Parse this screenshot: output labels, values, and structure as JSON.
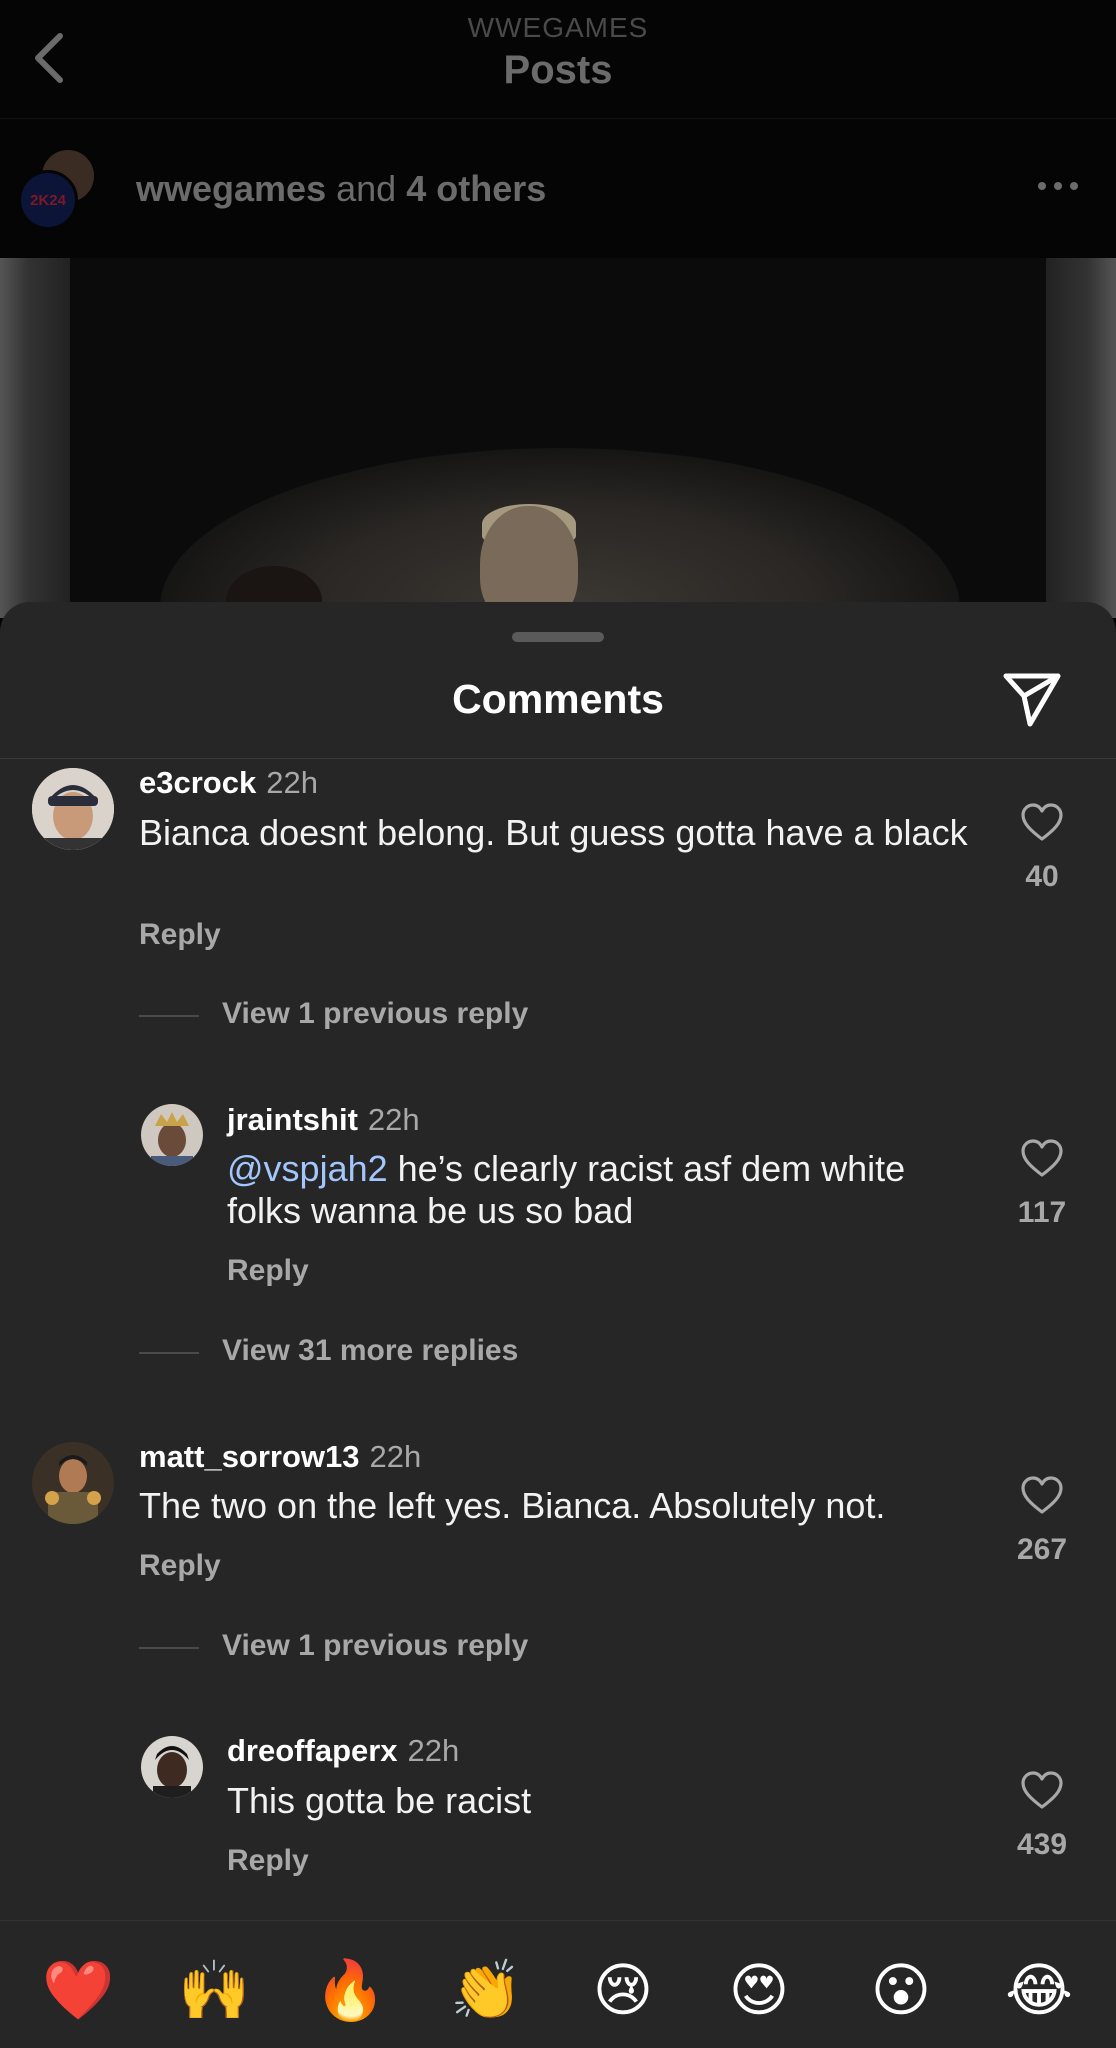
{
  "header": {
    "account": "WWEGAMES",
    "title": "Posts"
  },
  "author": {
    "name": "wwegames",
    "joiner": "and",
    "others": "4 others",
    "badge": "2K24"
  },
  "comments_sheet": {
    "title": "Comments"
  },
  "comments": [
    {
      "username": "e3crock",
      "time": "22h",
      "text": "Bianca doesnt belong. But guess gotta have a black",
      "reply": "Reply",
      "likes": "40"
    },
    {
      "view_replies": "View 1 previous reply"
    },
    {
      "username": "jraintshit",
      "time": "22h",
      "mention": "@vspjah2",
      "text": " he’s clearly racist asf dem white folks wanna be us so bad",
      "reply": "Reply",
      "likes": "117"
    },
    {
      "view_replies": "View 31 more replies"
    },
    {
      "username": "matt_sorrow13",
      "time": "22h",
      "text": "The two on the left yes. Bianca. Absolutely not.",
      "reply": "Reply",
      "likes": "267"
    },
    {
      "view_replies": "View 1 previous reply"
    },
    {
      "username": "dreoffaperx",
      "time": "22h",
      "text": "This gotta be racist",
      "reply": "Reply",
      "likes": "439"
    }
  ],
  "emoji_bar": [
    "❤️",
    "🙌",
    "🔥",
    "👏",
    "😢",
    "😍",
    "😮",
    "😂"
  ]
}
